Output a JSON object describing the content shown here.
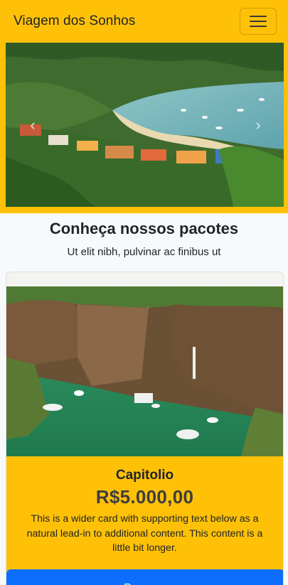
{
  "navbar": {
    "brand": "Viagem dos Sonhos",
    "menu_icon": "hamburger-icon"
  },
  "carousel": {
    "prev_icon": "chevron-left-icon",
    "next_icon": "chevron-right-icon"
  },
  "packages": {
    "title": "Conheça nossos pacotes",
    "subtitle": "Ut elit nibh, pulvinar ac finibus ut"
  },
  "card": {
    "title": "Capitolio",
    "price": "R$5.000,00",
    "text": "This is a wider card with supporting text below as a natural lead-in to additional content. This content is a little bit longer.",
    "button_label": "Reservar"
  },
  "colors": {
    "accent": "#ffc107",
    "button": "#0d6efd"
  }
}
